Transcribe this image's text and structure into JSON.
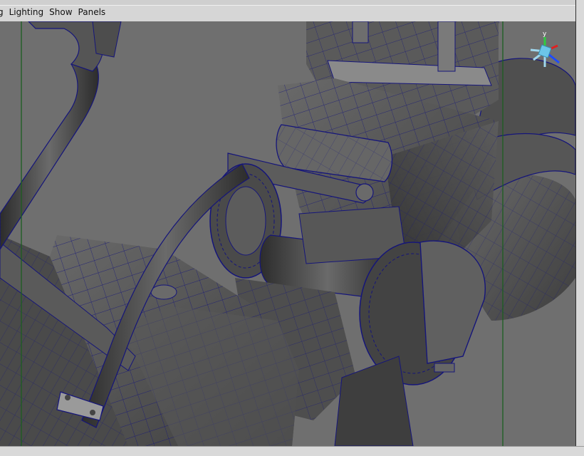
{
  "menu": {
    "items": [
      {
        "label": "g"
      },
      {
        "label": "Lighting"
      },
      {
        "label": "Show"
      },
      {
        "label": "Panels"
      }
    ]
  },
  "view_cube": {
    "axis_label": "y",
    "colors": {
      "y": "#2ecc40",
      "x": "#e02020",
      "z": "#1e4bff",
      "cube": "#6cc6e8"
    }
  },
  "viewport": {
    "background": "#6f6f6f",
    "mesh_fill": "#595959",
    "wire_color": "#13137a",
    "guide_color": "#1b5e20"
  }
}
